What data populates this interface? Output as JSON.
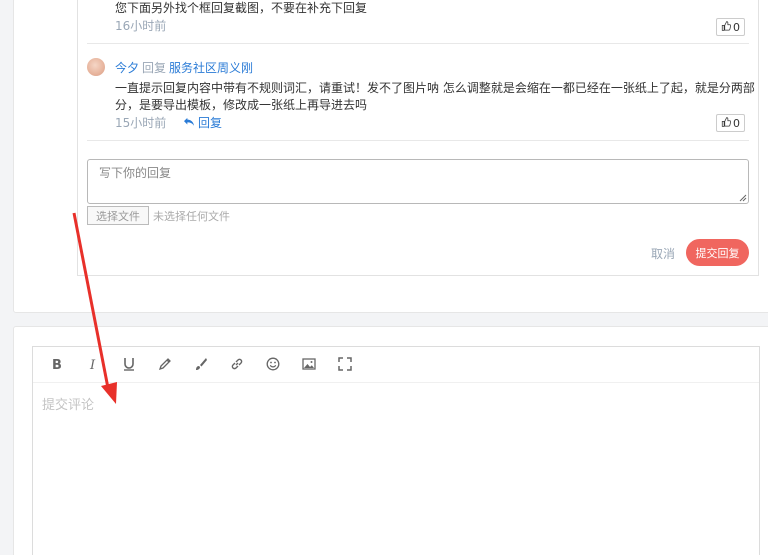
{
  "comments": [
    {
      "text": "您下面另外找个框回复截图，不要在补充下回复",
      "time": "16小时前",
      "likes": "0"
    },
    {
      "author": "今夕",
      "reply_word": "回复",
      "reply_target": "服务社区周义刚",
      "text_line1": "一直提示回复内容中带有不规则词汇，请重试！发不了图片呐 怎么调整就是会缩在一都已经在一张纸上了起，就是分两部",
      "text_line2": "分，是要导出模板，修改成一张纸上再导进去吗",
      "time": "15小时前",
      "reply_link": "回复",
      "likes": "0"
    }
  ],
  "reply_form": {
    "placeholder": "写下你的回复",
    "file_button": "选择文件",
    "file_status": "未选择任何文件",
    "cancel": "取消",
    "submit": "提交回复"
  },
  "editor": {
    "tools": [
      "bold-icon",
      "italic-icon",
      "underline-icon",
      "pencil-icon",
      "brush-icon",
      "link-icon",
      "emoji-icon",
      "image-icon",
      "fullscreen-icon"
    ],
    "placeholder": "提交评论"
  },
  "colors": {
    "accent": "#2a7bd6",
    "submit": "#f0665f",
    "annotation_arrow": "#e8302a"
  }
}
